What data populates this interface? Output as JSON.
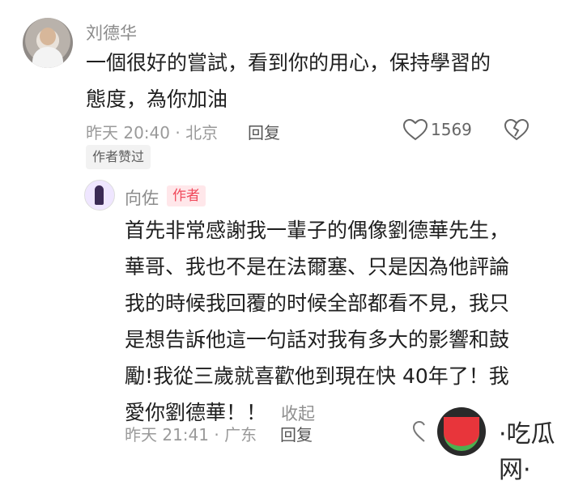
{
  "comment": {
    "author": "刘德华",
    "lines": [
      "一個很好的嘗試，看到你的用心，保持學習的",
      "態度，為你加油"
    ],
    "timestamp": "昨天 20:40 · 北京",
    "reply_label": "回复",
    "like_count": "1569",
    "author_liked_badge": "作者赞过"
  },
  "reply": {
    "author": "向佐",
    "author_tag": "作者",
    "lines": [
      "首先非常感謝我一輩子的偶像劉德華先生，",
      "華哥、我也不是在法爾塞、只是因為他評論",
      "我的時候我回覆的时候全部都看不見，我只",
      "是想告訴他這一句話对我有多大的影響和鼓",
      "勵!我從三歲就喜歡他到現在快 40年了！我",
      "愛你劉德華！！"
    ],
    "collapse_label": "收起",
    "timestamp": "昨天 21:41 · 广东",
    "reply_label": "回复"
  },
  "watermark": {
    "text": "·吃瓜网·",
    "icon": "watermelon-icon"
  },
  "icons": {
    "like": "heart-icon",
    "dislike": "broken-heart-icon",
    "partial": "heart-icon"
  }
}
